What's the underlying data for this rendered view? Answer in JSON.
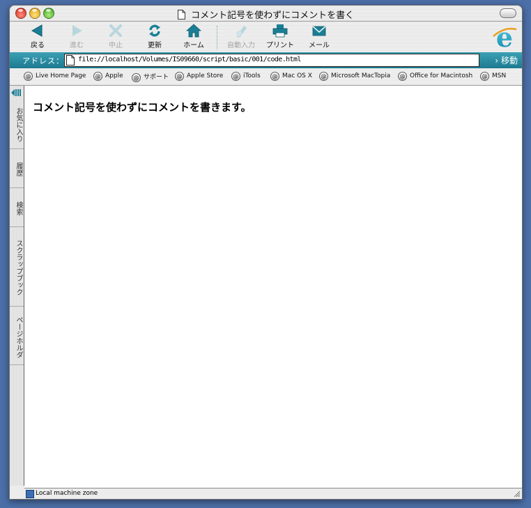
{
  "window": {
    "title": "コメント記号を使わずにコメントを書く"
  },
  "toolbar": {
    "back": "戻る",
    "forward": "進む",
    "stop": "中止",
    "refresh": "更新",
    "home": "ホーム",
    "autofill": "自動入力",
    "print": "プリント",
    "mail": "メール"
  },
  "address": {
    "label": "アドレス：",
    "url": "file://localhost/Volumes/IS09660/script/basic/001/code.html",
    "go": "移動"
  },
  "favorites": [
    "Live Home Page",
    "Apple",
    "サポート",
    "Apple Store",
    "iTools",
    "Mac OS X",
    "Microsoft MacTopia",
    "Office for Macintosh",
    "MSN"
  ],
  "explorer_tabs": [
    "お気に入り",
    "履歴",
    "検索",
    "スクラップブック",
    "ページホルダ"
  ],
  "content": {
    "text": "コメント記号を使わずにコメントを書きます。"
  },
  "status": {
    "zone": "Local machine zone"
  },
  "colors": {
    "accent": "#1c8aa0",
    "icon_teal": "#1a7f96"
  }
}
